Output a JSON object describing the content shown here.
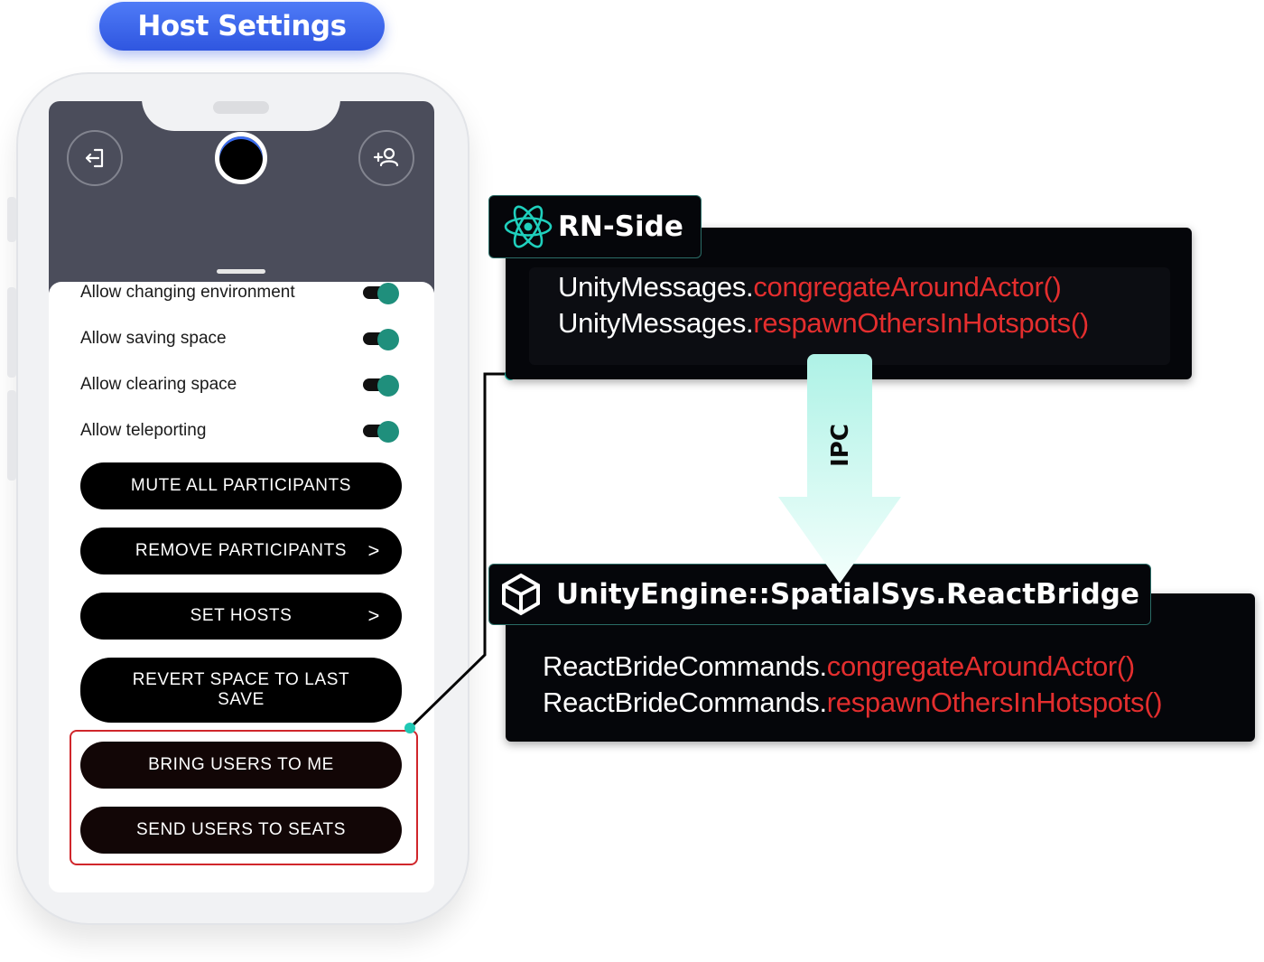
{
  "header": {
    "title": "Host Settings"
  },
  "phone": {
    "toggles": [
      {
        "label": "Allow changing environment",
        "on": true
      },
      {
        "label": "Allow saving space",
        "on": true
      },
      {
        "label": "Allow clearing space",
        "on": true
      },
      {
        "label": "Allow teleporting",
        "on": true
      }
    ],
    "buttons": {
      "mute": "MUTE ALL PARTICIPANTS",
      "remove": "REMOVE PARTICIPANTS",
      "set_hosts": "SET HOSTS",
      "revert": "REVERT SPACE TO LAST SAVE",
      "bring": "BRING USERS TO ME",
      "send": "SEND USERS TO SEATS",
      "chevron": ">"
    },
    "icons": [
      "exit-icon",
      "add-user-icon",
      "avatar"
    ]
  },
  "rn": {
    "title": "RN-Side",
    "icon": "react-icon",
    "lines": [
      {
        "prefix": "UnityMessages.",
        "method": "congregateAroundActor()"
      },
      {
        "prefix": "UnityMessages.",
        "method": "respawnOthersInHotspots()"
      }
    ]
  },
  "ipc": {
    "label": "IPC"
  },
  "unity": {
    "title": "UnityEngine::SpatialSys.ReactBridge",
    "icon": "unity-icon",
    "lines": [
      {
        "prefix": "ReactBrideCommands.",
        "method": "congregateAroundActor()"
      },
      {
        "prefix": "ReactBrideCommands.",
        "method": "respawnOthersInHotspots()"
      }
    ]
  },
  "colors": {
    "accent_blue": "#2f56e0",
    "toggle_green": "#1f8f7c",
    "method_red": "#e42e2e",
    "connector_teal": "#1fc8b4",
    "highlight_red": "#d0262b"
  }
}
